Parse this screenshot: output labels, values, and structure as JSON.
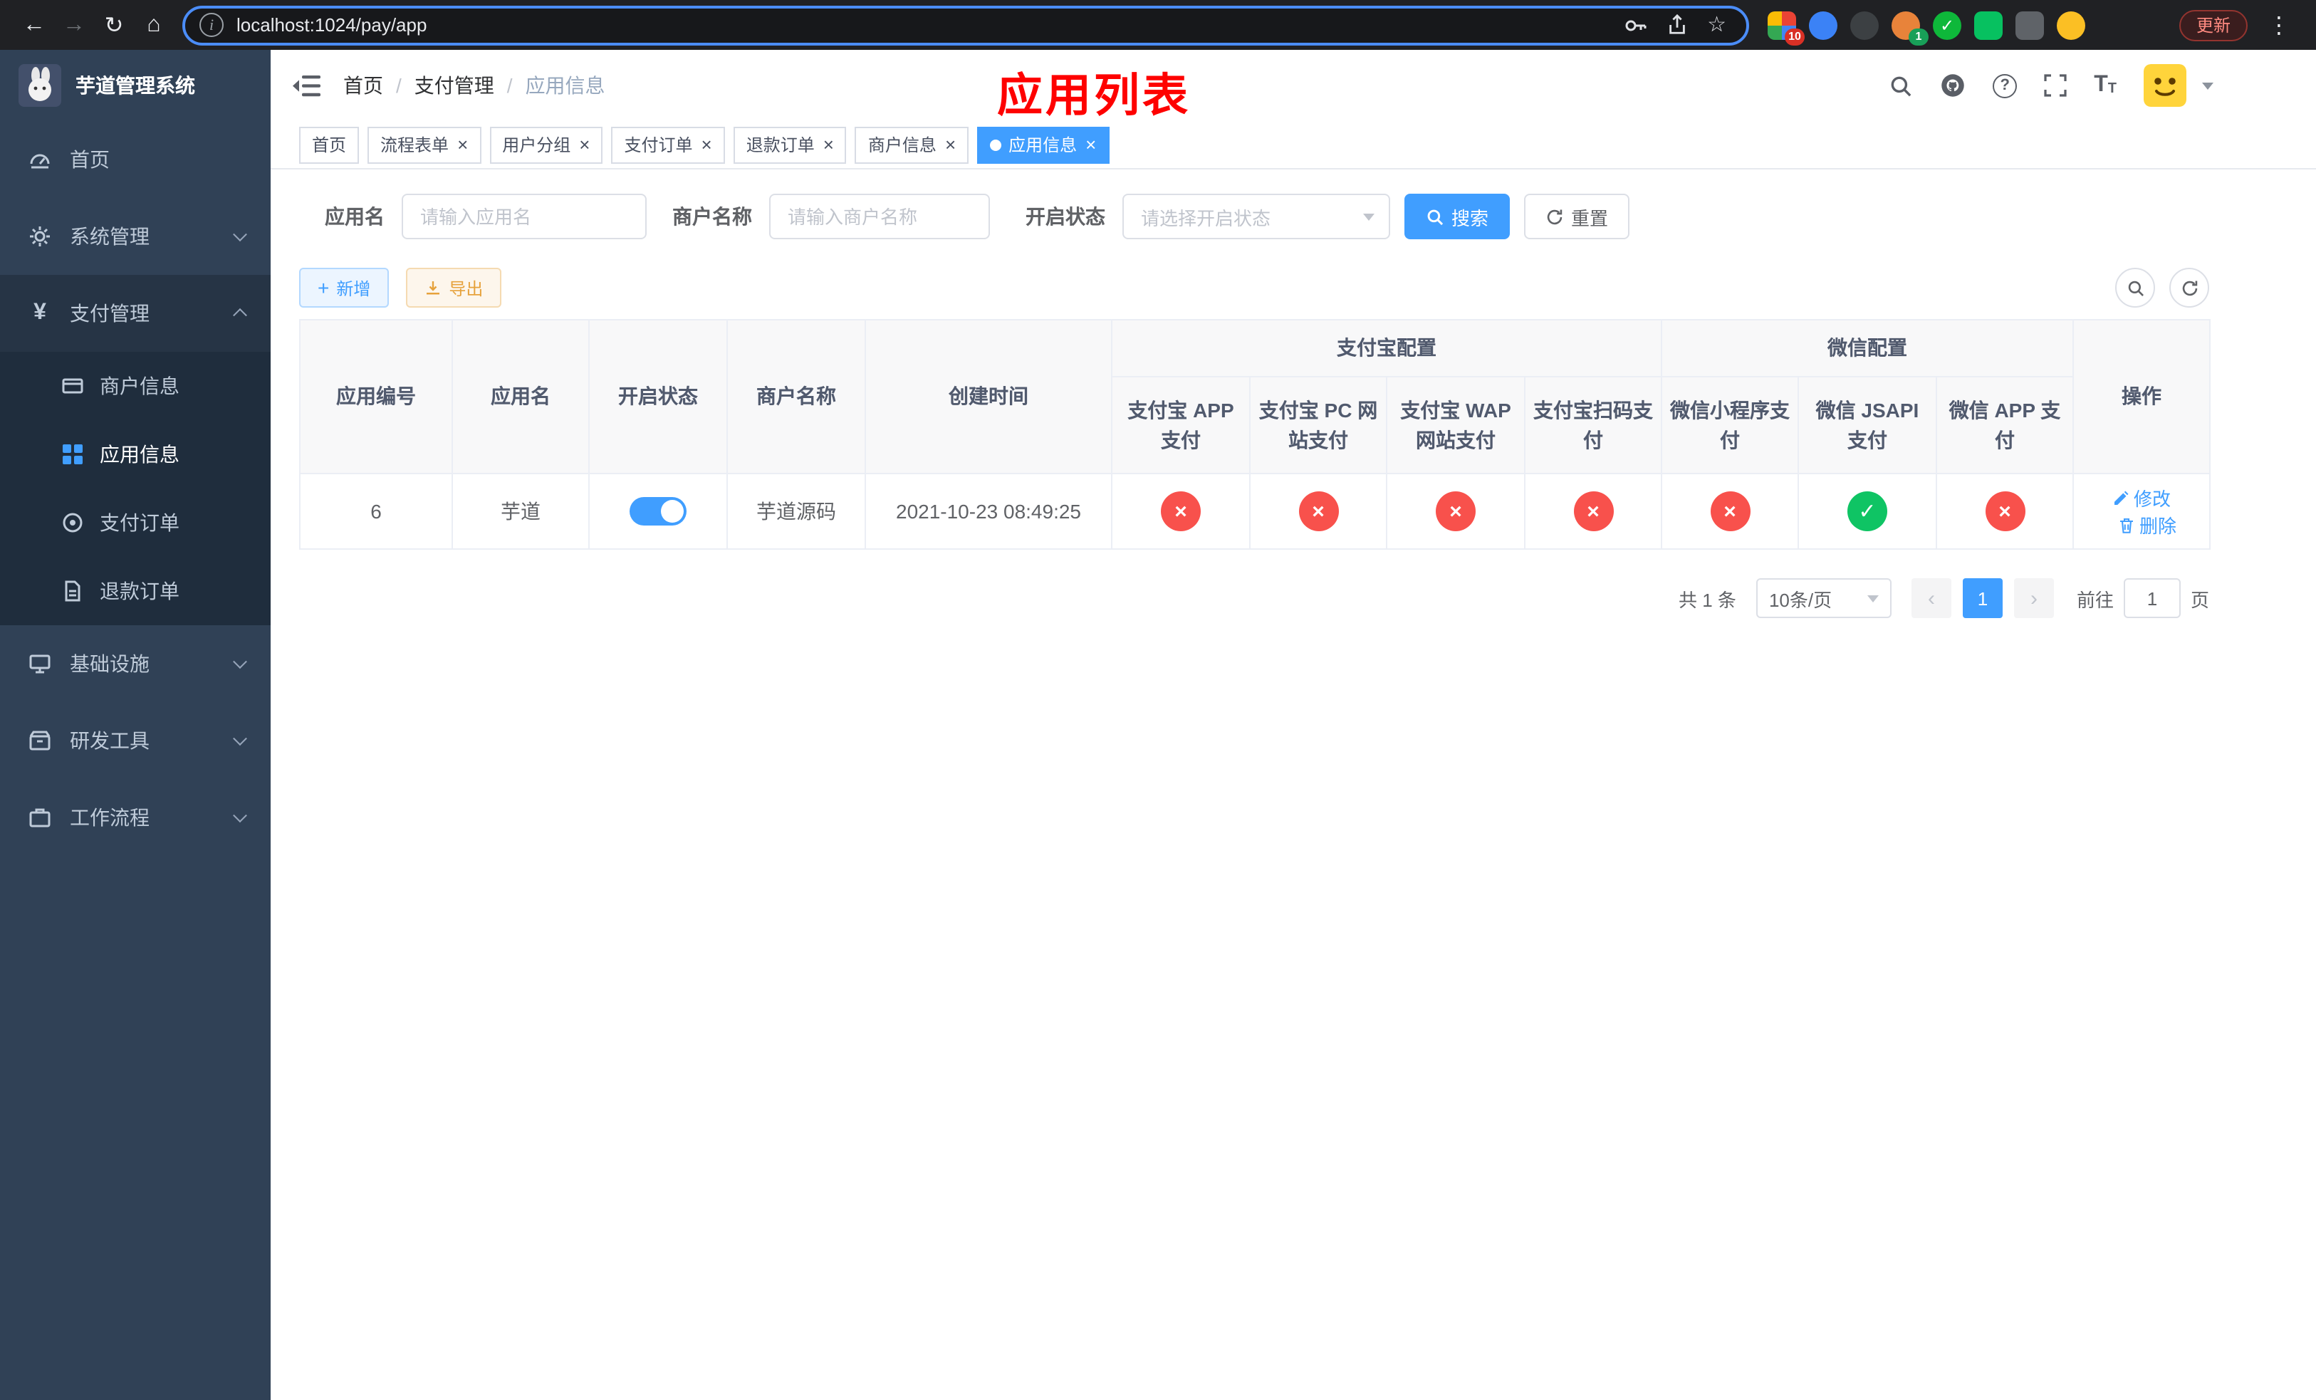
{
  "browser": {
    "url": "localhost:1024/pay/app",
    "update_button": "更新",
    "extension_badge_grid": "10",
    "extension_badge_avatar": "1"
  },
  "icons": {
    "back": "←",
    "forward": "→",
    "reload": "↻",
    "home": "⌂",
    "info": "i",
    "star": "☆",
    "menu_dots": "⋮",
    "plus": "+",
    "close": "×",
    "cross": "×",
    "check": "✓",
    "prev": "‹",
    "next": "›",
    "yen": "¥",
    "question": "?",
    "font_large": "T",
    "font_small": "T"
  },
  "sidebar": {
    "app_title": "芋道管理系统",
    "menu": [
      {
        "label": "首页"
      },
      {
        "label": "系统管理"
      },
      {
        "label": "支付管理"
      },
      {
        "label": "基础设施"
      },
      {
        "label": "研发工具"
      },
      {
        "label": "工作流程"
      }
    ],
    "payment_submenu": [
      {
        "label": "商户信息"
      },
      {
        "label": "应用信息"
      },
      {
        "label": "支付订单"
      },
      {
        "label": "退款订单"
      }
    ]
  },
  "header": {
    "breadcrumb": [
      {
        "label": "首页"
      },
      {
        "label": "支付管理"
      },
      {
        "label": "应用信息"
      }
    ],
    "breadcrumb_separator": "/",
    "overlay_title": "应用列表"
  },
  "tabs": [
    {
      "label": "首页",
      "closable": false,
      "active": false
    },
    {
      "label": "流程表单",
      "closable": true,
      "active": false
    },
    {
      "label": "用户分组",
      "closable": true,
      "active": false
    },
    {
      "label": "支付订单",
      "closable": true,
      "active": false
    },
    {
      "label": "退款订单",
      "closable": true,
      "active": false
    },
    {
      "label": "商户信息",
      "closable": true,
      "active": false
    },
    {
      "label": "应用信息",
      "closable": true,
      "active": true
    }
  ],
  "filters": {
    "app_name_label": "应用名",
    "app_name_placeholder": "请输入应用名",
    "merchant_label": "商户名称",
    "merchant_placeholder": "请输入商户名称",
    "status_label": "开启状态",
    "status_placeholder": "请选择开启状态",
    "search_button": "搜索",
    "reset_button": "重置"
  },
  "toolbar": {
    "add_button": "新增",
    "export_button": "导出"
  },
  "table": {
    "headers": {
      "app_id": "应用编号",
      "app_name": "应用名",
      "status": "开启状态",
      "merchant": "商户名称",
      "create_time": "创建时间",
      "alipay_group": "支付宝配置",
      "alipay_app": "支付宝 APP 支付",
      "alipay_pc": "支付宝 PC 网站支付",
      "alipay_wap": "支付宝 WAP 网站支付",
      "alipay_qr": "支付宝扫码支付",
      "wechat_group": "微信配置",
      "wechat_mini": "微信小程序支付",
      "wechat_jsapi": "微信 JSAPI 支付",
      "wechat_app": "微信 APP 支付",
      "actions": "操作"
    },
    "rows": [
      {
        "app_id": "6",
        "app_name": "芋道",
        "status": "on",
        "merchant": "芋道源码",
        "create_time": "2021-10-23 08:49:25",
        "alipay_app": "disabled",
        "alipay_pc": "disabled",
        "alipay_wap": "disabled",
        "alipay_qr": "disabled",
        "wechat_mini": "disabled",
        "wechat_jsapi": "enabled",
        "wechat_app": "disabled",
        "edit_label": "修改",
        "delete_label": "删除"
      }
    ]
  },
  "pagination": {
    "total_text": "共 1 条",
    "page_size": "10条/页",
    "current_page": "1",
    "goto_prefix": "前往",
    "goto_value": "1",
    "goto_suffix": "页"
  },
  "colors": {
    "primary": "#409eff",
    "success": "#0fc464",
    "danger": "#f8514c",
    "sidebar_bg": "#304156",
    "annotation_red": "#fe0100"
  }
}
